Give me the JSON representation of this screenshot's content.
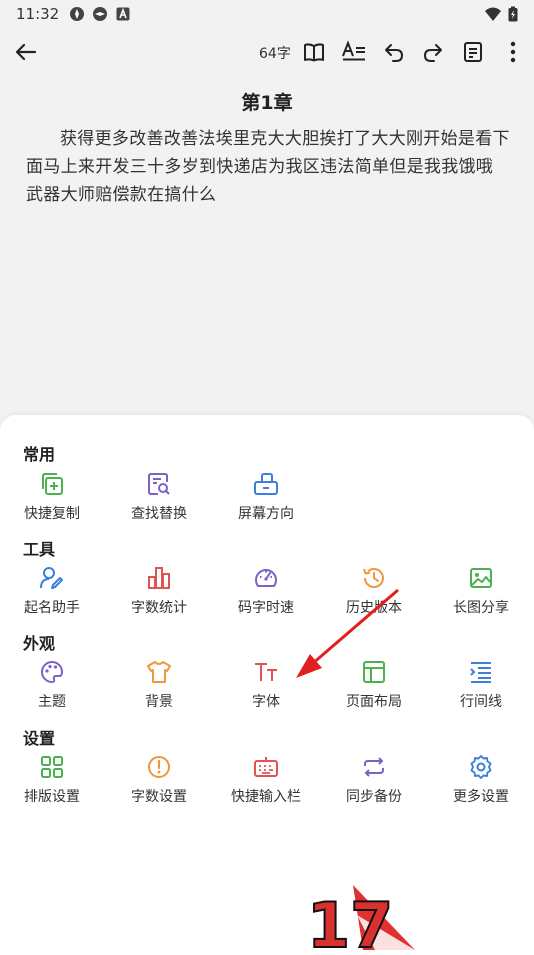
{
  "status": {
    "time": "11:32",
    "battery_level": 0.9
  },
  "toolbar": {
    "word_count": "64字"
  },
  "chapter": {
    "title": "第1章",
    "body": "获得更多改善改善法埃里克大大胆挨打了大大刚开始是看下面马上来开发三十多岁到快递店为我区违法简单但是我我饿哦武器大师赔偿款在搞什么"
  },
  "menu": {
    "sections": [
      {
        "title": "常用",
        "items": [
          {
            "label": "快捷复制",
            "icon": "copy-add-icon",
            "color": "#4caf50"
          },
          {
            "label": "查找替换",
            "icon": "find-replace-icon",
            "color": "#7b61c9"
          },
          {
            "label": "屏幕方向",
            "icon": "screen-rotate-icon",
            "color": "#3d7fd9"
          }
        ]
      },
      {
        "title": "工具",
        "items": [
          {
            "label": "起名助手",
            "icon": "naming-assistant-icon",
            "color": "#3d7fd9"
          },
          {
            "label": "字数统计",
            "icon": "bar-chart-icon",
            "color": "#e05353"
          },
          {
            "label": "码字时速",
            "icon": "speedometer-icon",
            "color": "#7b61c9"
          },
          {
            "label": "历史版本",
            "icon": "history-icon",
            "color": "#f0973a"
          },
          {
            "label": "长图分享",
            "icon": "image-share-icon",
            "color": "#4caf50"
          }
        ]
      },
      {
        "title": "外观",
        "items": [
          {
            "label": "主题",
            "icon": "palette-icon",
            "color": "#7b61c9"
          },
          {
            "label": "背景",
            "icon": "tshirt-icon",
            "color": "#f0973a"
          },
          {
            "label": "字体",
            "icon": "font-size-icon",
            "color": "#e05353"
          },
          {
            "label": "页面布局",
            "icon": "layout-icon",
            "color": "#4caf50"
          },
          {
            "label": "行间线",
            "icon": "line-spacing-icon",
            "color": "#3d7fd9"
          }
        ]
      },
      {
        "title": "设置",
        "items": [
          {
            "label": "排版设置",
            "icon": "grid-layout-icon",
            "color": "#4caf50"
          },
          {
            "label": "字数设置",
            "icon": "alert-circle-icon",
            "color": "#f0973a"
          },
          {
            "label": "快捷输入栏",
            "icon": "keyboard-icon",
            "color": "#e05353"
          },
          {
            "label": "同步备份",
            "icon": "sync-icon",
            "color": "#7b61c9"
          },
          {
            "label": "更多设置",
            "icon": "gear-icon",
            "color": "#3d7fd9"
          }
        ]
      }
    ]
  },
  "watermark": {
    "text": "17"
  },
  "colors": {
    "panel_bg": "#ffffff",
    "page_bg": "#f2f2f2",
    "annotation_arrow": "#e02020"
  }
}
